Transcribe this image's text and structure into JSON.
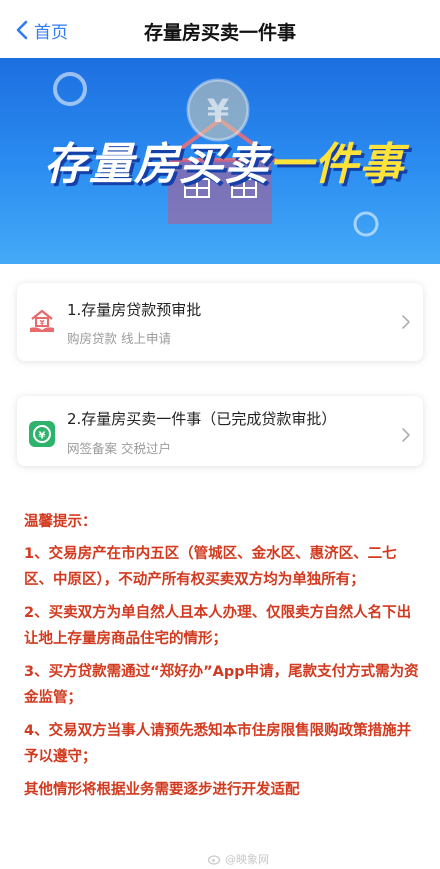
{
  "nav": {
    "back_label": "首页",
    "title": "存量房买卖一件事"
  },
  "banner": {
    "title_white": "存量房买卖",
    "title_yellow": "一件事",
    "coin_symbol": "¥"
  },
  "cards": [
    {
      "title": "1.存量房贷款预审批",
      "subtitle": "购房贷款 线上申请",
      "icon": "house-hand-icon",
      "icon_color": "#e96a6a"
    },
    {
      "title": "2.存量房买卖一件事（已完成贷款审批）",
      "subtitle": "网签备案 交税过户",
      "icon": "yuan-circle-icon",
      "icon_color": "#2db36c"
    }
  ],
  "notice": {
    "title": "温馨提示：",
    "items": [
      "1、交易房产在市内五区（管城区、金水区、惠济区、二七区、中原区），不动产所有权买卖双方均为单独所有；",
      "2、买卖双方为单自然人且本人办理、仅限卖方自然人名下出让地上存量房商品住宅的情形；",
      "3、买方贷款需通过“郑好办”App申请，尾款支付方式需为资金监管；",
      "4、交易双方当事人请预先悉知本市住房限售限购政策措施并予以遵守；",
      "其他情形将根据业务需要逐步进行开发适配"
    ]
  },
  "watermark": {
    "text": "@映象网"
  },
  "colors": {
    "accent": "#2f7cf6",
    "notice": "#d23a1f",
    "banner_blue": "#1d6fe0",
    "banner_yellow": "#ffe23a"
  }
}
